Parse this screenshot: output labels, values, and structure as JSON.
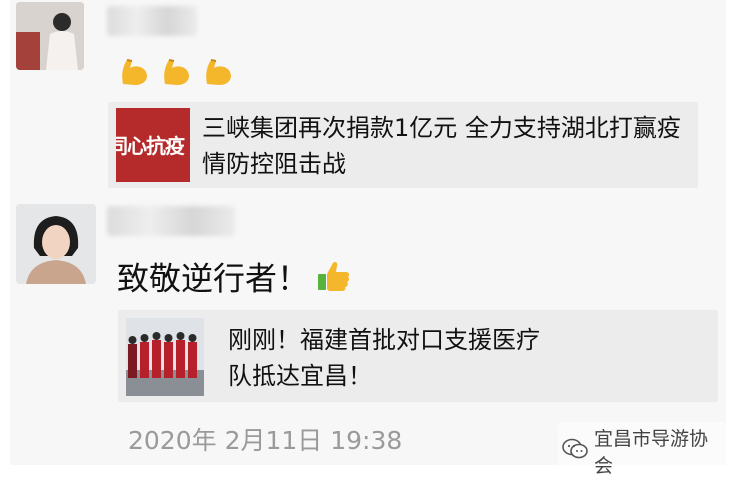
{
  "messages": [
    {
      "emoji_icons": [
        "flexed-biceps-icon",
        "flexed-biceps-icon",
        "flexed-biceps-icon"
      ],
      "link_card": {
        "thumb_text": "同心抗疫",
        "title": "三峡集团再次捐款1亿元 全力支持湖北打赢疫情防控阻击战"
      }
    },
    {
      "text": "致敬逆行者！",
      "text_icon": "thumbs-up-icon",
      "link_card": {
        "title": "刚刚！福建首批对口支援医疗队抵达宜昌！"
      }
    }
  ],
  "timestamp": "2020年 2月11日 19:38",
  "watermark": {
    "icon": "wechat-icon",
    "text": "宜昌市导游协会"
  },
  "colors": {
    "panel_bg": "#f7f7f7",
    "card_bg": "#ececec",
    "thumb_red": "#b52a2a",
    "timestamp": "#9a9a9a",
    "emoji_yellow": "#f4b62a"
  }
}
